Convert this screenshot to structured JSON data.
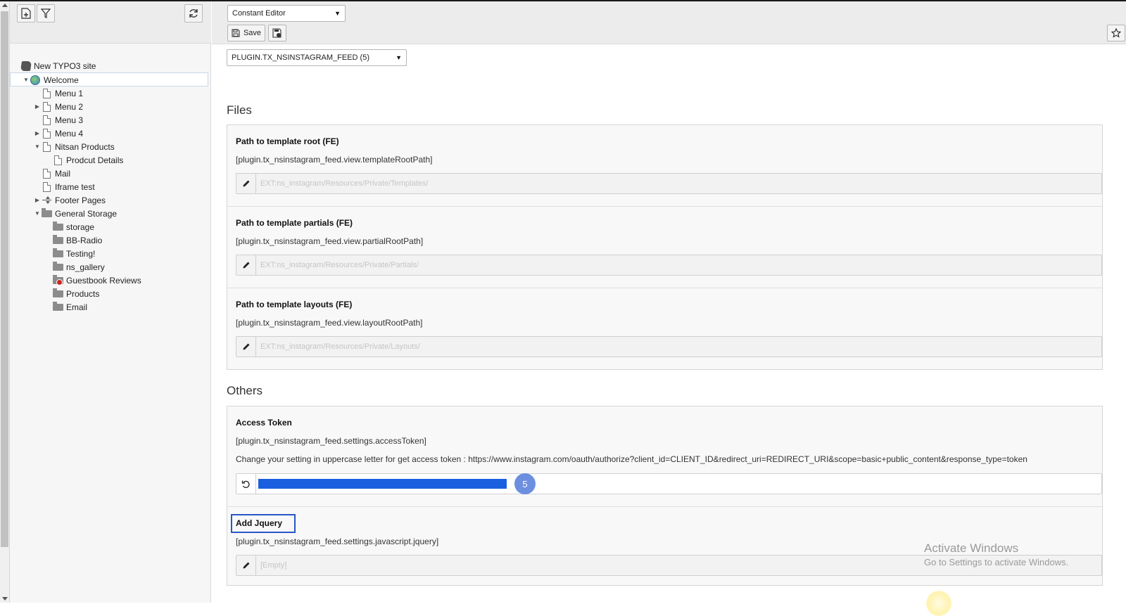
{
  "tree_panel": {
    "toolbar": {
      "new_page_icon": "new-page-icon",
      "filter_icon": "filter-icon",
      "refresh_icon": "refresh-icon"
    },
    "root_label": "New TYPO3 site",
    "items": [
      {
        "label": "Welcome",
        "icon": "globe",
        "toggle": "▼"
      },
      {
        "label": "Menu 1",
        "icon": "page",
        "toggle": ""
      },
      {
        "label": "Menu 2",
        "icon": "page",
        "toggle": "▶"
      },
      {
        "label": "Menu 3",
        "icon": "page",
        "toggle": ""
      },
      {
        "label": "Menu 4",
        "icon": "page",
        "toggle": "▶"
      },
      {
        "label": "Nitsan Products",
        "icon": "page",
        "toggle": "▼"
      },
      {
        "label": "Prodcut Details",
        "icon": "page",
        "toggle": ""
      },
      {
        "label": "Mail",
        "icon": "page",
        "toggle": ""
      },
      {
        "label": "Iframe test",
        "icon": "page",
        "toggle": ""
      },
      {
        "label": "Footer Pages",
        "icon": "separator",
        "toggle": "▶"
      },
      {
        "label": "General Storage",
        "icon": "folder",
        "toggle": "▼"
      },
      {
        "label": "storage",
        "icon": "folder",
        "toggle": ""
      },
      {
        "label": "BB-Radio",
        "icon": "folder",
        "toggle": ""
      },
      {
        "label": "Testing!",
        "icon": "folder",
        "toggle": ""
      },
      {
        "label": "ns_gallery",
        "icon": "folder",
        "toggle": ""
      },
      {
        "label": "Guestbook Reviews",
        "icon": "folder-restricted",
        "toggle": ""
      },
      {
        "label": "Products",
        "icon": "folder",
        "toggle": ""
      },
      {
        "label": "Email",
        "icon": "folder",
        "toggle": ""
      }
    ]
  },
  "header": {
    "module_select": "Constant Editor",
    "save_label": "Save",
    "category_select": "PLUGIN.TX_NSINSTAGRAM_FEED (5)"
  },
  "files_section": {
    "title": "Files",
    "fields": [
      {
        "title": "Path to template root (FE)",
        "key": "[plugin.tx_nsinstagram_feed.view.templateRootPath]",
        "placeholder": "EXT:ns_instagram/Resources/Private/Templates/"
      },
      {
        "title": "Path to template partials (FE)",
        "key": "[plugin.tx_nsinstagram_feed.view.partialRootPath]",
        "placeholder": "EXT:ns_instagram/Resources/Private/Partials/"
      },
      {
        "title": "Path to template layouts (FE)",
        "key": "[plugin.tx_nsinstagram_feed.view.layoutRootPath]",
        "placeholder": "EXT:ns_instagram/Resources/Private/Layouts/"
      }
    ]
  },
  "others_section": {
    "title": "Others",
    "access_token": {
      "title": "Access Token",
      "key": "[plugin.tx_nsinstagram_feed.settings.accessToken]",
      "description": "Change your setting in uppercase letter for get access token : https://www.instagram.com/oauth/authorize?client_id=CLIENT_ID&redirect_uri=REDIRECT_URI&scope=basic+public_content&response_type=token",
      "step_badge": "5"
    },
    "add_jquery": {
      "title": "Add Jquery",
      "key": "[plugin.tx_nsinstagram_feed.settings.javascript.jquery]",
      "placeholder": "[Empty]"
    }
  },
  "watermark": {
    "line1": "Activate Windows",
    "line2": "Go to Settings to activate Windows."
  },
  "colors": {
    "accent": "#2856c8",
    "selection": "#1a5fe0",
    "badge": "#6c8fe0"
  }
}
